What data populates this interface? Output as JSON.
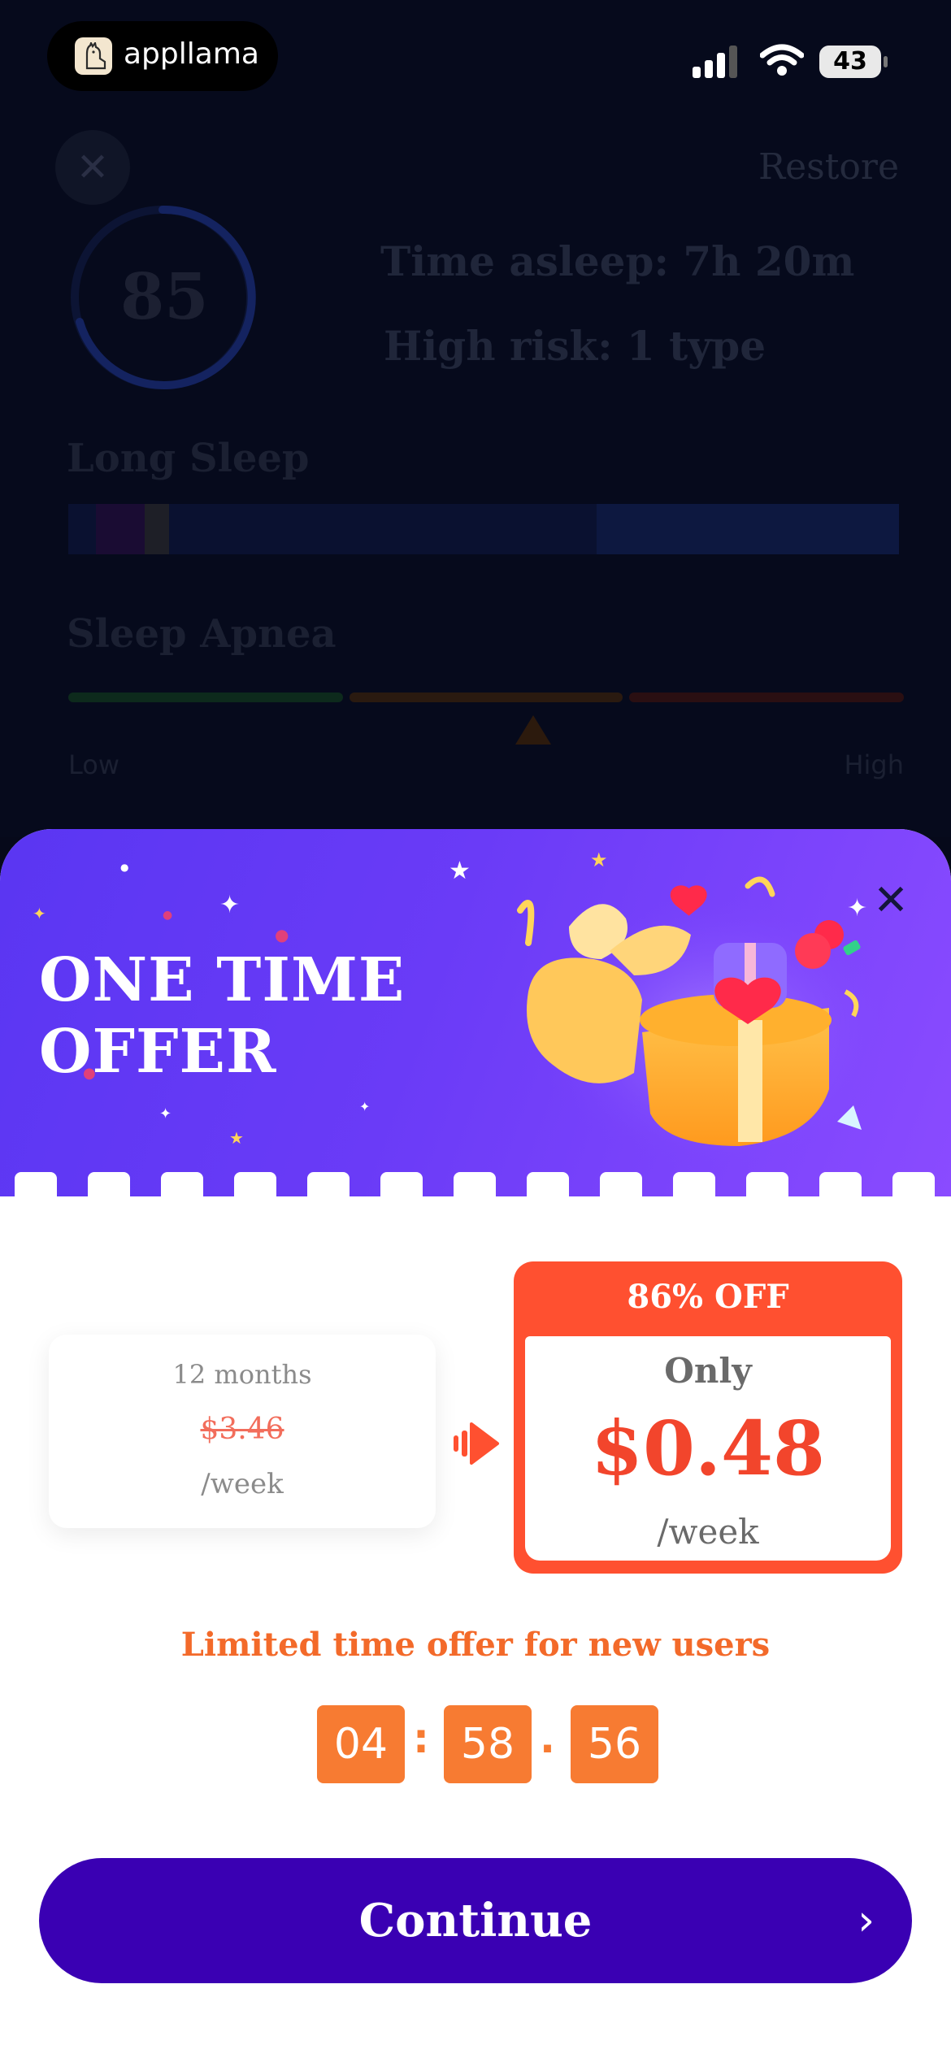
{
  "status_bar": {
    "brand": "appllama",
    "battery": "43"
  },
  "background_screen": {
    "restore_label": "Restore",
    "score": "85",
    "time_asleep": "Time asleep: 7h 20m",
    "high_risk": "High risk:   1 type",
    "section_long_sleep": "Long Sleep",
    "section_sleep_apnea": "Sleep Apnea",
    "scale_low": "Low",
    "scale_high": "High"
  },
  "offer": {
    "title": "ONE TIME OFFER",
    "old_plan": {
      "duration": "12 months",
      "price": "$3.46",
      "period": "/week"
    },
    "new_plan": {
      "discount": "86% OFF",
      "only_label": "Only",
      "price": "$0.48",
      "period": "/week"
    },
    "limited_text": "Limited time offer for new users",
    "timer": {
      "hours": "04",
      "minutes": "58",
      "seconds": "56",
      "sep1": ":",
      "sep2": "."
    },
    "continue_label": "Continue"
  },
  "colors": {
    "hero_purple": "#6a3bf7",
    "accent_orange": "#ff5030",
    "timer_orange": "#f77b32",
    "button_purple": "#3a00b3"
  }
}
